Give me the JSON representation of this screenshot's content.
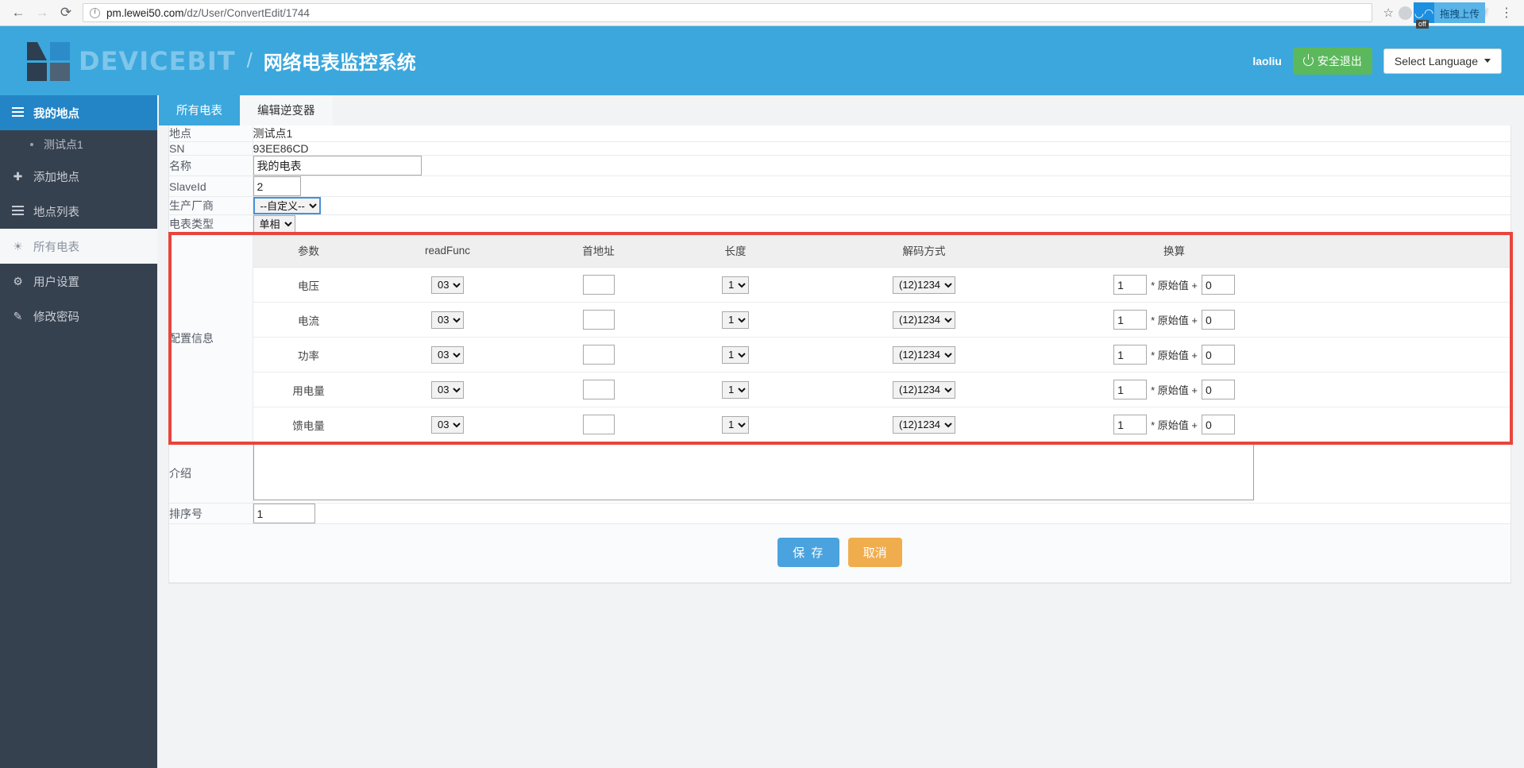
{
  "browser": {
    "back_icon": "←",
    "forward_icon": "→",
    "reload_icon": "⟳",
    "url_prefix": "pm.lewei50.com",
    "url_path": "/dz/User/ConvertEdit/1744",
    "star_icon": "☆",
    "extension_tooltip": "拖拽上传",
    "extension_badge": "off",
    "menu_icon": "⋮"
  },
  "header": {
    "brand": "DEVICEBIT",
    "separator": "/",
    "subtitle": "网络电表监控系统",
    "user": "laoliu",
    "logout_label": "安全退出",
    "language_label": "Select Language",
    "accent_color": "#3ba7dd",
    "logout_color": "#5cb85c"
  },
  "sidebar": {
    "items": [
      {
        "label": "我的地点",
        "icon": "list-icon",
        "state": "active"
      },
      {
        "label": "测试点1",
        "icon": "dot-icon",
        "state": "sub"
      },
      {
        "label": "添加地点",
        "icon": "plus-icon",
        "state": "normal"
      },
      {
        "label": "地点列表",
        "icon": "list-alt-icon",
        "state": "normal"
      },
      {
        "label": "所有电表",
        "icon": "dashboard-icon",
        "state": "light"
      },
      {
        "label": "用户设置",
        "icon": "gear-icon",
        "state": "normal"
      },
      {
        "label": "修改密码",
        "icon": "edit-icon",
        "state": "normal"
      }
    ]
  },
  "tabs": [
    {
      "label": "所有电表",
      "active": false
    },
    {
      "label": "编辑逆变器",
      "active": true
    }
  ],
  "form": {
    "site": {
      "label": "地点",
      "value": "测试点1"
    },
    "sn": {
      "label": "SN",
      "value": "93EE86CD"
    },
    "name": {
      "label": "名称",
      "value": "我的电表"
    },
    "slaveid": {
      "label": "SlaveId",
      "value": "2"
    },
    "manufacturer": {
      "label": "生产厂商",
      "value": "--自定义--"
    },
    "meter_type": {
      "label": "电表类型",
      "value": "单相"
    },
    "config": {
      "label": "配置信息"
    },
    "intro": {
      "label": "介绍",
      "value": ""
    },
    "sort": {
      "label": "排序号",
      "value": "1"
    }
  },
  "config_table": {
    "headers": [
      "参数",
      "readFunc",
      "首地址",
      "长度",
      "解码方式",
      "换算"
    ],
    "rows": [
      {
        "param": "电压",
        "readFunc": "03",
        "addr": "",
        "len": "1",
        "decode": "(12)1234",
        "conv_mul": "1",
        "conv_mid": "* 原始值 +",
        "conv_add": "0"
      },
      {
        "param": "电流",
        "readFunc": "03",
        "addr": "",
        "len": "1",
        "decode": "(12)1234",
        "conv_mul": "1",
        "conv_mid": "* 原始值 +",
        "conv_add": "0"
      },
      {
        "param": "功率",
        "readFunc": "03",
        "addr": "",
        "len": "1",
        "decode": "(12)1234",
        "conv_mul": "1",
        "conv_mid": "* 原始值 +",
        "conv_add": "0"
      },
      {
        "param": "用电量",
        "readFunc": "03",
        "addr": "",
        "len": "1",
        "decode": "(12)1234",
        "conv_mul": "1",
        "conv_mid": "* 原始值 +",
        "conv_add": "0"
      },
      {
        "param": "馈电量",
        "readFunc": "03",
        "addr": "",
        "len": "1",
        "decode": "(12)1234",
        "conv_mul": "1",
        "conv_mid": "* 原始值 +",
        "conv_add": "0"
      }
    ],
    "highlight_color": "#e8453c"
  },
  "buttons": {
    "save": "保 存",
    "cancel": "取消",
    "save_color": "#4aa3df",
    "cancel_color": "#f0ad4e"
  }
}
